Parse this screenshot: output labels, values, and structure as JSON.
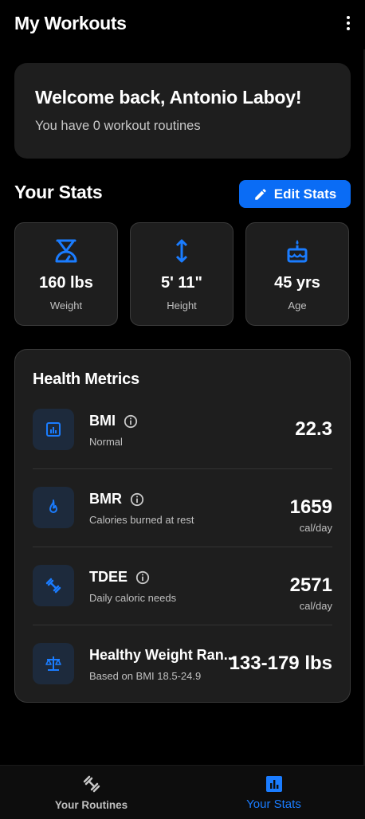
{
  "appbar": {
    "title": "My Workouts",
    "menu_icon": "more-vert-icon"
  },
  "welcome": {
    "heading": "Welcome back, Antonio Laboy!",
    "subtitle": "You have 0 workout routines"
  },
  "stats": {
    "section_title": "Your Stats",
    "edit_label": "Edit Stats",
    "cards": [
      {
        "icon": "scale-icon",
        "value": "160 lbs",
        "label": "Weight"
      },
      {
        "icon": "height-icon",
        "value": "5' 11\"",
        "label": "Height"
      },
      {
        "icon": "cake-icon",
        "value": "45 yrs",
        "label": "Age"
      }
    ]
  },
  "metrics": {
    "title": "Health Metrics",
    "rows": [
      {
        "icon": "analytics-icon",
        "name": "BMI",
        "desc": "Normal",
        "value": "22.3",
        "unit": ""
      },
      {
        "icon": "flame-icon",
        "name": "BMR",
        "desc": "Calories burned at rest",
        "value": "1659",
        "unit": "cal/day"
      },
      {
        "icon": "dumbbell-icon",
        "name": "TDEE",
        "desc": "Daily caloric needs",
        "value": "2571",
        "unit": "cal/day"
      },
      {
        "icon": "balance-icon",
        "name": "Healthy Weight Ran...",
        "desc": "Based on BMI 18.5-24.9",
        "value": "133-179 lbs",
        "unit": ""
      }
    ]
  },
  "nav": {
    "items": [
      {
        "icon": "dumbbell-icon",
        "label": "Your Routines",
        "active": false
      },
      {
        "icon": "bar-chart-icon",
        "label": "Your Stats",
        "active": true
      }
    ]
  },
  "colors": {
    "accent": "#0a6cf5",
    "icon_blue": "#1a7cff",
    "card_bg": "#1e1e1e",
    "icon_box_bg": "#1d2a3c"
  }
}
